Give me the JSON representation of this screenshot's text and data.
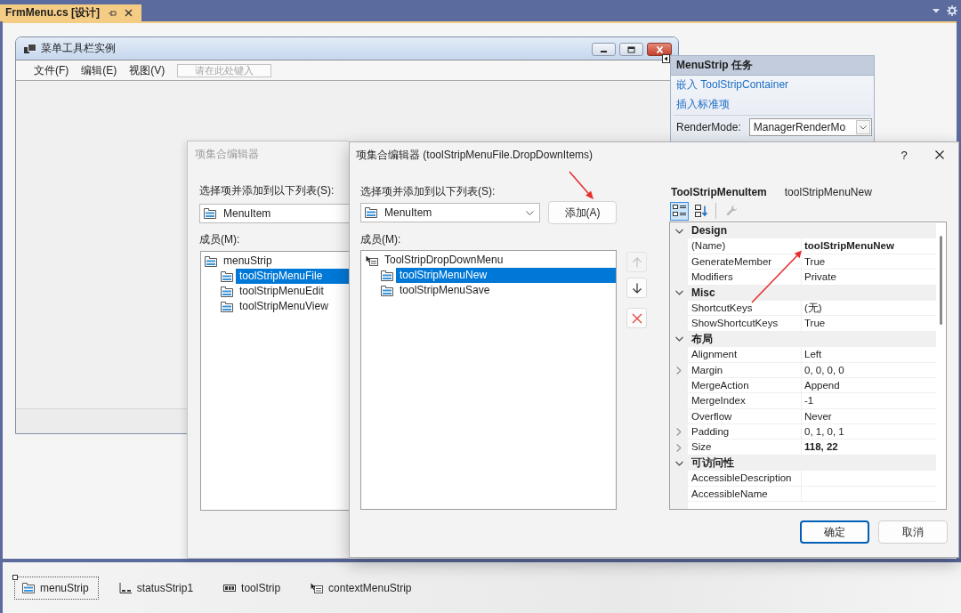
{
  "doc_tab": {
    "title": "FrmMenu.cs [设计]",
    "selected": true
  },
  "form": {
    "title": "菜单工具栏实例",
    "menu": [
      "文件(F)",
      "编辑(E)",
      "视图(V)"
    ],
    "menu_placeholder": "请在此处键入"
  },
  "smart_tag": {
    "title": "MenuStrip 任务",
    "links": [
      "嵌入 ToolStripContainer",
      "插入标准项"
    ],
    "render_mode_label": "RenderMode:",
    "render_mode_value": "ManagerRenderMo"
  },
  "back_dialog": {
    "title": "项集合编辑器",
    "select_label": "选择项并添加到以下列表(S):",
    "item_type": "MenuItem",
    "members_label": "成员(M):",
    "members": [
      {
        "label": "menuStrip",
        "kind": "menu",
        "selected": false,
        "children": [
          {
            "label": "toolStripMenuFile",
            "kind": "menu",
            "selected": true
          },
          {
            "label": "toolStripMenuEdit",
            "kind": "menu",
            "selected": false
          },
          {
            "label": "toolStripMenuView",
            "kind": "menu",
            "selected": false
          }
        ]
      }
    ]
  },
  "dialog": {
    "title": "项集合编辑器 (toolStripMenuFile.DropDownItems)",
    "help_button": "?",
    "select_label": "选择项并添加到以下列表(S):",
    "item_type": "MenuItem",
    "add_button": "添加(A)",
    "members_label": "成员(M):",
    "members": [
      {
        "label": "ToolStripDropDownMenu",
        "kind": "context_menu",
        "selected": false,
        "children": [
          {
            "label": "toolStripMenuNew",
            "kind": "menu",
            "selected": true
          },
          {
            "label": "toolStripMenuSave",
            "kind": "menu",
            "selected": false
          }
        ]
      }
    ],
    "member_buttons": [
      {
        "kind": "up",
        "disabled": true
      },
      {
        "kind": "down",
        "disabled": false
      },
      {
        "kind": "delete",
        "disabled": false
      }
    ],
    "properties": {
      "type_name": "ToolStripMenuItem",
      "object_name": "toolStripMenuNew",
      "toolbar": [
        {
          "kind": "categorized",
          "selected": true,
          "disabled": false
        },
        {
          "kind": "alphabetical",
          "selected": false,
          "disabled": false
        },
        {
          "kind": "property_pages",
          "selected": false,
          "disabled": true
        }
      ],
      "categories": [
        {
          "name": "Design",
          "expanded": true,
          "properties": [
            {
              "name": "(Name)",
              "value": "toolStripMenuNew",
              "modified": true,
              "expandable": false
            },
            {
              "name": "GenerateMember",
              "value": "True",
              "modified": false,
              "expandable": false
            },
            {
              "name": "Modifiers",
              "value": "Private",
              "modified": false,
              "expandable": false
            }
          ]
        },
        {
          "name": "Misc",
          "expanded": true,
          "properties": [
            {
              "name": "ShortcutKeys",
              "value": "(无)",
              "modified": false,
              "expandable": false
            },
            {
              "name": "ShowShortcutKeys",
              "value": "True",
              "modified": false,
              "expandable": false
            }
          ]
        },
        {
          "name": "布局",
          "expanded": true,
          "properties": [
            {
              "name": "Alignment",
              "value": "Left",
              "modified": false,
              "expandable": false
            },
            {
              "name": "Margin",
              "value": "0, 0, 0, 0",
              "modified": false,
              "expandable": true
            },
            {
              "name": "MergeAction",
              "value": "Append",
              "modified": false,
              "expandable": false
            },
            {
              "name": "MergeIndex",
              "value": "-1",
              "modified": false,
              "expandable": false
            },
            {
              "name": "Overflow",
              "value": "Never",
              "modified": false,
              "expandable": false
            },
            {
              "name": "Padding",
              "value": "0, 1, 0, 1",
              "modified": false,
              "expandable": true
            },
            {
              "name": "Size",
              "value": "118, 22",
              "modified": true,
              "expandable": true
            }
          ]
        },
        {
          "name": "可访问性",
          "expanded": true,
          "properties": [
            {
              "name": "AccessibleDescription",
              "modified": false,
              "expandable": false
            },
            {
              "name": "AccessibleName",
              "modified": false,
              "expandable": false
            }
          ]
        }
      ]
    },
    "buttons": [
      {
        "label": "确定",
        "default": true
      },
      {
        "label": "取消",
        "default": false
      }
    ]
  },
  "tray": [
    {
      "label": "menuStrip",
      "kind": "menu",
      "selected": true
    },
    {
      "label": "statusStrip1",
      "kind": "status",
      "selected": false
    },
    {
      "label": "toolStrip",
      "kind": "toolbar",
      "selected": false
    },
    {
      "label": "contextMenuStrip",
      "kind": "context_menu",
      "selected": false
    }
  ]
}
